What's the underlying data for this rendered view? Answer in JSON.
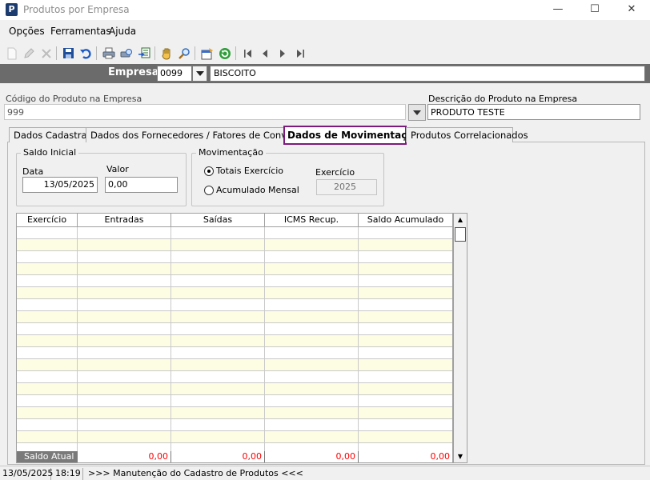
{
  "window": {
    "title": "Produtos por Empresa",
    "app_icon_letter": "P"
  },
  "window_controls": {
    "minimize": "—",
    "maximize": "☐",
    "close": "✕"
  },
  "menu": [
    "Opções",
    "Ferramentas",
    "Ajuda"
  ],
  "toolbar": {
    "icons": [
      "new-icon",
      "edit-icon",
      "delete-icon",
      "save-icon",
      "undo-icon",
      "print-icon",
      "print-preview-icon",
      "export-icon",
      "hand-icon",
      "search-icon",
      "properties-icon",
      "refresh-icon",
      "first-icon",
      "prev-icon",
      "next-icon",
      "last-icon"
    ]
  },
  "empresa": {
    "label": "Empresa",
    "code": "0099",
    "name": "BISCOITO"
  },
  "produto": {
    "codigo_label": "Código do Produto na Empresa",
    "codigo_value": "999",
    "descricao_label": "Descrição do Produto na Empresa",
    "descricao_value": "PRODUTO TESTE"
  },
  "tabs": [
    {
      "label": "Dados Cadastrais",
      "active": false
    },
    {
      "label": "Dados dos Fornecedores / Fatores de Conversão",
      "active": false
    },
    {
      "label": "Dados de Movimentação",
      "active": true
    },
    {
      "label": "Produtos Correlacionados",
      "active": false
    }
  ],
  "saldo_inicial": {
    "title": "Saldo Inicial",
    "data_label": "Data",
    "data_value": "13/05/2025",
    "valor_label": "Valor",
    "valor_value": "0,00"
  },
  "movimentacao": {
    "title": "Movimentação",
    "opt_totais": "Totais Exercício",
    "opt_acumulado": "Acumulado Mensal",
    "selected": "totais",
    "exercicio_label": "Exercício",
    "exercicio_value": "2025"
  },
  "grid": {
    "columns": [
      "Exercício",
      "Entradas",
      "Saídas",
      "ICMS Recup.",
      "Saldo Acumulado"
    ],
    "footer_label": "Saldo Atual",
    "footer_values": [
      "0,00",
      "0,00",
      "0,00",
      "0,00"
    ]
  },
  "statusbar": {
    "date": "13/05/2025",
    "time": "18:19",
    "message": ">>> Manutenção do Cadastro de Produtos <<<"
  },
  "colors": {
    "active_tab_border": "#7d1a7d",
    "row_alt": "#fdfde4",
    "footer_value": "#ff0000",
    "empresa_bar": "#6b6b6b"
  }
}
